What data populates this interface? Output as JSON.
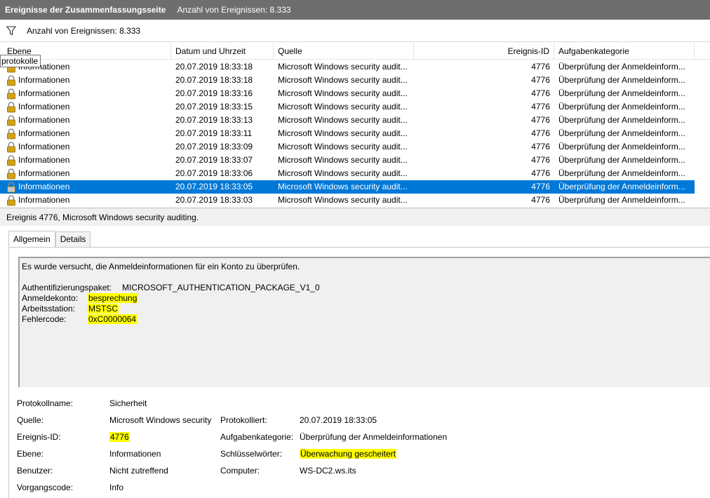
{
  "titlebar": {
    "title": "Ereignisse der Zusammenfassungsseite",
    "count_text": "Anzahl von Ereignissen: 8.333"
  },
  "filterbar": {
    "icon": "filter-icon",
    "text": "Anzahl von Ereignissen: 8.333"
  },
  "grid": {
    "columns": [
      "Ebene",
      "Datum und Uhrzeit",
      "Quelle",
      "Ereignis-ID",
      "Aufgabenkategorie"
    ],
    "tooltip": "protokolle",
    "rows": [
      {
        "level": "Informationen",
        "date": "20.07.2019 18:33:18",
        "source": "Microsoft Windows security audit...",
        "id": "4776",
        "category": "Überprüfung der Anmeldeinform...",
        "selected": false
      },
      {
        "level": "Informationen",
        "date": "20.07.2019 18:33:18",
        "source": "Microsoft Windows security audit...",
        "id": "4776",
        "category": "Überprüfung der Anmeldeinform...",
        "selected": false
      },
      {
        "level": "Informationen",
        "date": "20.07.2019 18:33:16",
        "source": "Microsoft Windows security audit...",
        "id": "4776",
        "category": "Überprüfung der Anmeldeinform...",
        "selected": false
      },
      {
        "level": "Informationen",
        "date": "20.07.2019 18:33:15",
        "source": "Microsoft Windows security audit...",
        "id": "4776",
        "category": "Überprüfung der Anmeldeinform...",
        "selected": false
      },
      {
        "level": "Informationen",
        "date": "20.07.2019 18:33:13",
        "source": "Microsoft Windows security audit...",
        "id": "4776",
        "category": "Überprüfung der Anmeldeinform...",
        "selected": false
      },
      {
        "level": "Informationen",
        "date": "20.07.2019 18:33:11",
        "source": "Microsoft Windows security audit...",
        "id": "4776",
        "category": "Überprüfung der Anmeldeinform...",
        "selected": false
      },
      {
        "level": "Informationen",
        "date": "20.07.2019 18:33:09",
        "source": "Microsoft Windows security audit...",
        "id": "4776",
        "category": "Überprüfung der Anmeldeinform...",
        "selected": false
      },
      {
        "level": "Informationen",
        "date": "20.07.2019 18:33:07",
        "source": "Microsoft Windows security audit...",
        "id": "4776",
        "category": "Überprüfung der Anmeldeinform...",
        "selected": false
      },
      {
        "level": "Informationen",
        "date": "20.07.2019 18:33:06",
        "source": "Microsoft Windows security audit...",
        "id": "4776",
        "category": "Überprüfung der Anmeldeinform...",
        "selected": false
      },
      {
        "level": "Informationen",
        "date": "20.07.2019 18:33:05",
        "source": "Microsoft Windows security audit...",
        "id": "4776",
        "category": "Überprüfung der Anmeldeinform...",
        "selected": true
      },
      {
        "level": "Informationen",
        "date": "20.07.2019 18:33:03",
        "source": "Microsoft Windows security audit...",
        "id": "4776",
        "category": "Überprüfung der Anmeldeinform...",
        "selected": false
      }
    ]
  },
  "detail": {
    "header": "Ereignis 4776, Microsoft Windows security auditing.",
    "tabs": [
      "Allgemein",
      "Details"
    ],
    "message": {
      "intro": "Es wurde versucht, die Anmeldeinformationen für ein Konto zu überprüfen.",
      "fields": [
        {
          "label": "Authentifizierungspaket:",
          "value": "MICROSOFT_AUTHENTICATION_PACKAGE_V1_0",
          "highlight": false
        },
        {
          "label": "Anmeldekonto:",
          "value": "besprechung",
          "highlight": true
        },
        {
          "label": "Arbeitsstation:",
          "value": "MSTSC",
          "highlight": true
        },
        {
          "label": "Fehlercode:",
          "value": "0xC0000064",
          "highlight": true
        }
      ]
    },
    "properties": {
      "log_name_label": "Protokollname:",
      "log_name": "Sicherheit",
      "source_label": "Quelle:",
      "source": "Microsoft Windows security",
      "logged_label": "Protokolliert:",
      "logged": "20.07.2019 18:33:05",
      "event_id_label": "Ereignis-ID:",
      "event_id": "4776",
      "task_category_label": "Aufgabenkategorie:",
      "task_category": "Überprüfung der Anmeldeinformationen",
      "level_label": "Ebene:",
      "level": "Informationen",
      "keywords_label": "Schlüsselwörter:",
      "keywords": "Überwachung gescheitert",
      "user_label": "Benutzer:",
      "user": "Nicht zutreffend",
      "computer_label": "Computer:",
      "computer": "WS-DC2.ws.its",
      "opcode_label": "Vorgangscode:",
      "opcode": "Info"
    },
    "highlight_color": "#ffff00"
  },
  "colors": {
    "titlebar": "#6e6e6e",
    "selection": "#0078d7",
    "lock": "#d4a017"
  }
}
